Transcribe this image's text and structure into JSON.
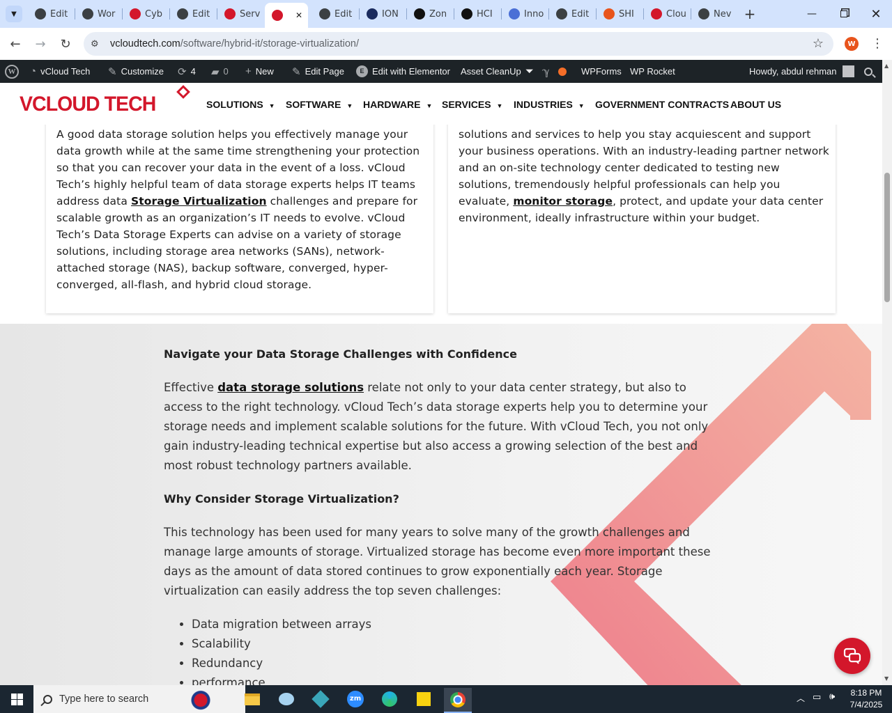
{
  "browser": {
    "tabs": [
      {
        "label": "Edit",
        "icon": "wordpress-icon",
        "color": "#3c4043"
      },
      {
        "label": "Wor",
        "icon": "wordpress-icon",
        "color": "#3c4043"
      },
      {
        "label": "Cyb",
        "icon": "vcloud-icon",
        "color": "#d3172b"
      },
      {
        "label": "Edit",
        "icon": "wordpress-icon",
        "color": "#3c4043"
      },
      {
        "label": "Serv",
        "icon": "vcloud-icon",
        "color": "#d3172b"
      },
      {
        "label": "",
        "icon": "vcloud-icon",
        "color": "#d3172b",
        "active": true
      },
      {
        "label": "Edit",
        "icon": "wordpress-icon",
        "color": "#3c4043"
      },
      {
        "label": "ION",
        "icon": "ion-icon",
        "color": "#1a2b5e"
      },
      {
        "label": "Zon",
        "icon": "zoominfo-icon",
        "color": "#111111"
      },
      {
        "label": "HCI",
        "icon": "openai-icon",
        "color": "#111111"
      },
      {
        "label": "Inno",
        "icon": "inno-icon",
        "color": "#4a6fd6"
      },
      {
        "label": "Edit",
        "icon": "wordpress-icon",
        "color": "#3c4043"
      },
      {
        "label": "SHI",
        "icon": "shi-icon",
        "color": "#e8541c"
      },
      {
        "label": "Clou",
        "icon": "cloud-icon",
        "color": "#d3172b"
      },
      {
        "label": "Nev",
        "icon": "chrome-new-icon",
        "color": "#3c4043"
      }
    ],
    "url_host": "vcloudtech.com",
    "url_path": "/software/hybrid-it/storage-virtualization/",
    "profile_initial": "W"
  },
  "adminbar": {
    "site_name": "vCloud Tech",
    "customize": "Customize",
    "updates_count": "4",
    "comments_count": "0",
    "new_label": "New",
    "edit_page": "Edit Page",
    "elementor": "Edit with Elementor",
    "asset_cleanup": "Asset CleanUp",
    "wpforms": "WPForms",
    "wprocket": "WP Rocket",
    "howdy": "Howdy, abdul rehman"
  },
  "site": {
    "logo_text": "VCLOUD TECH",
    "menu": [
      {
        "label": "SOLUTIONS",
        "has_caret": true
      },
      {
        "label": "SOFTWARE",
        "has_caret": true
      },
      {
        "label": "HARDWARE",
        "has_caret": true
      },
      {
        "label": "SERVICES",
        "has_caret": true
      },
      {
        "label": "INDUSTRIES",
        "has_caret": true
      },
      {
        "label": "GOVERNMENT CONTRACTS",
        "has_caret": false
      },
      {
        "label": "ABOUT US",
        "has_caret": false
      }
    ]
  },
  "cards": {
    "left": {
      "before": "A good data storage solution helps you effectively manage your data growth while at the same time strengthening your protection so that you can recover your data in the event of a loss. vCloud Tech’s highly helpful team of data storage experts helps IT teams address data ",
      "link": "Storage Virtualization",
      "after": " challenges and prepare for scalable growth as an organization’s IT needs to evolve. vCloud Tech’s Data Storage Experts can advise on a variety of storage solutions, including storage area networks (SANs), network-attached storage (NAS), backup software, converged, hyper-converged, all-flash, and hybrid cloud storage."
    },
    "right": {
      "before": "solutions and services to help you stay acquiescent and support your business operations. With an industry-leading partner network and an on-site technology center dedicated to testing new solutions, tremendously helpful professionals can help you evaluate, ",
      "link": "monitor storage",
      "after": ", protect, and update your data center environment, ideally infrastructure within your budget."
    }
  },
  "section": {
    "heading1": "Navigate your Data Storage Challenges with Confidence",
    "p1_before": "Effective ",
    "p1_link": "data storage solutions",
    "p1_after": " relate not only to your data center strategy, but also to access to the right technology. vCloud Tech’s data storage experts help you to determine your storage needs and implement scalable solutions for the future. With vCloud Tech, you not only gain industry-leading technical expertise but also access a growing selection of the best and most robust technology partners available.",
    "heading2": "Why Consider Storage Virtualization?",
    "p2": "This technology has been used for many years to solve many of the growth challenges and manage large amounts of storage. Virtualized storage has become even more important these days as the amount of data stored continues to grow exponentially each year. Storage virtualization can easily  address the  top seven challenges:",
    "bullets": [
      "Data migration between arrays",
      "Scalability",
      "Redundancy",
      "performance"
    ]
  },
  "taskbar": {
    "search_placeholder": "Type here to search",
    "time": "8:18 PM",
    "date": "7/4/2025"
  },
  "colors": {
    "brand_red": "#d3172b",
    "admin_bar": "#1d2327",
    "tab_strip": "#d3e3fd",
    "taskbar": "#1b2631"
  }
}
